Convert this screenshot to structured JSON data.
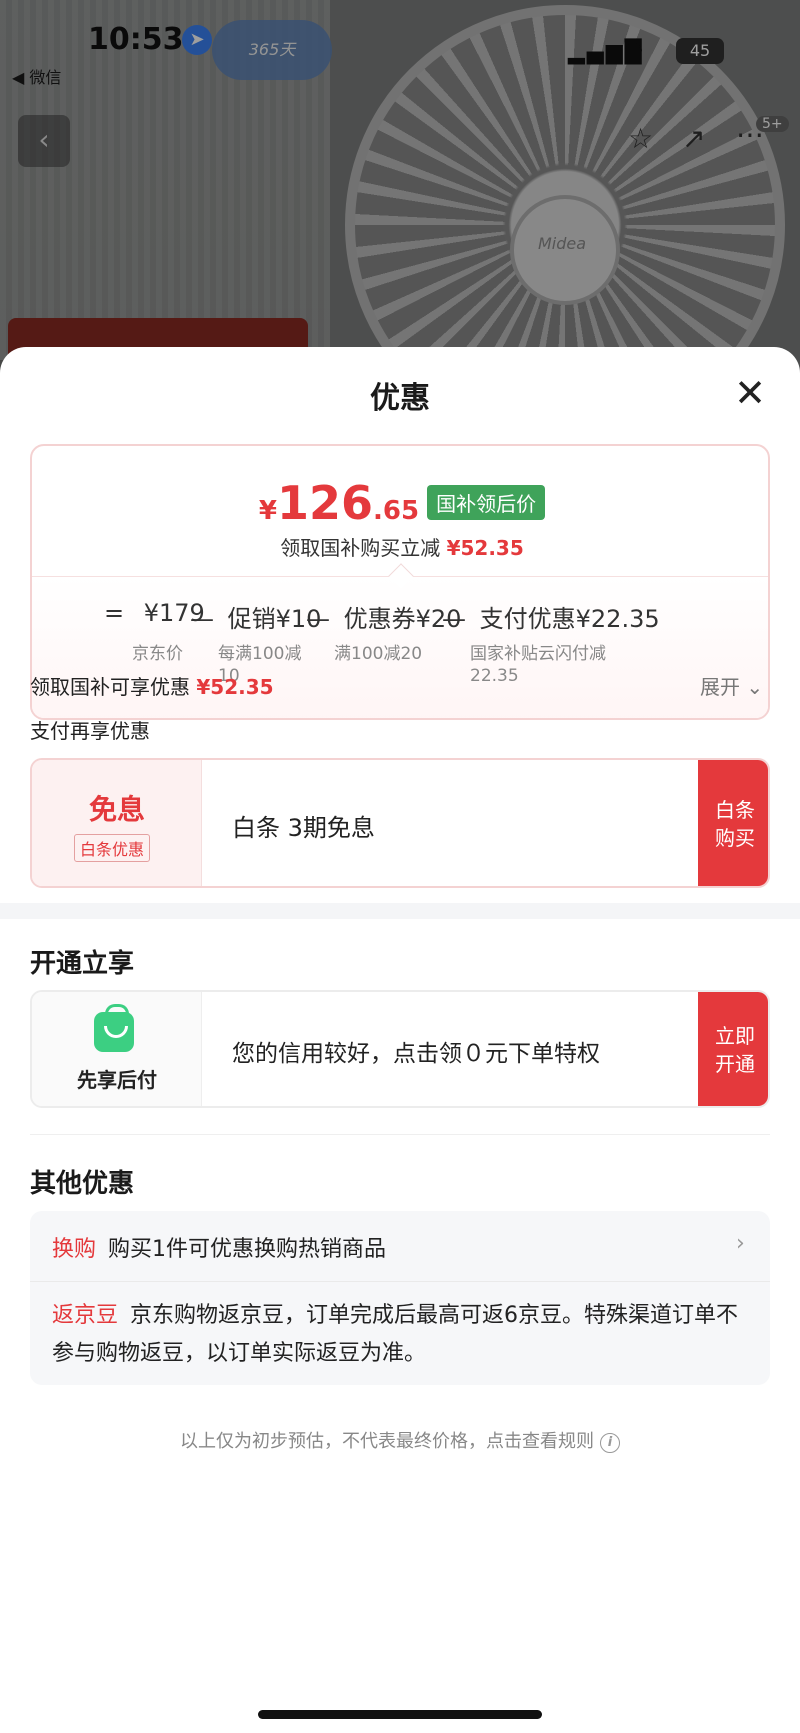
{
  "status_bar": {
    "time": "10:53",
    "back_app": "◀ 微信",
    "battery": "45"
  },
  "background": {
    "promo_badge": "365天",
    "brand": "Midea"
  },
  "nav": {
    "more_count": "5+"
  },
  "sheet": {
    "title": "优惠",
    "price": {
      "currency": "¥",
      "integer": "126",
      "decimal": ".65",
      "tag": "国补领后价",
      "subtitle_prefix": "领取国补购买立减",
      "subtitle_value": "¥52.35"
    },
    "breakdown": [
      {
        "symbol": "=",
        "text": "¥179",
        "label": "京东价"
      },
      {
        "symbol": "—",
        "text": "促销¥10",
        "label": "每满100减\n10"
      },
      {
        "symbol": "—",
        "text": "优惠券¥20",
        "label": "满100减20"
      },
      {
        "symbol": "—",
        "text": "支付优惠¥22.35",
        "label": "国家补贴云闪付减\n22.35"
      }
    ],
    "subsidy_row": {
      "label": "领取国补可享优惠",
      "value": "¥52.35",
      "expand": "展开"
    },
    "pay_section": {
      "label": "支付再享优惠",
      "title": "免息",
      "badge": "白条优惠",
      "desc": "白条 3期免息",
      "button": "白条\n购买"
    },
    "open_section": {
      "heading": "开通立享",
      "label": "先享后付",
      "desc": "您的信用较好，点击领０元下单特权",
      "button": "立即\n开通"
    },
    "other_section": {
      "heading": "其他优惠",
      "items": [
        {
          "tag": "换购",
          "text": "购买1件可优惠换购热销商品"
        },
        {
          "tag": "返京豆",
          "text": "京东购物返京豆，订单完成后最高可返6京豆。特殊渠道订单不参与购物返豆，以订单实际返豆为准。"
        }
      ]
    },
    "footnote": "以上仅为初步预估，不代表最终价格，点击查看规则"
  }
}
